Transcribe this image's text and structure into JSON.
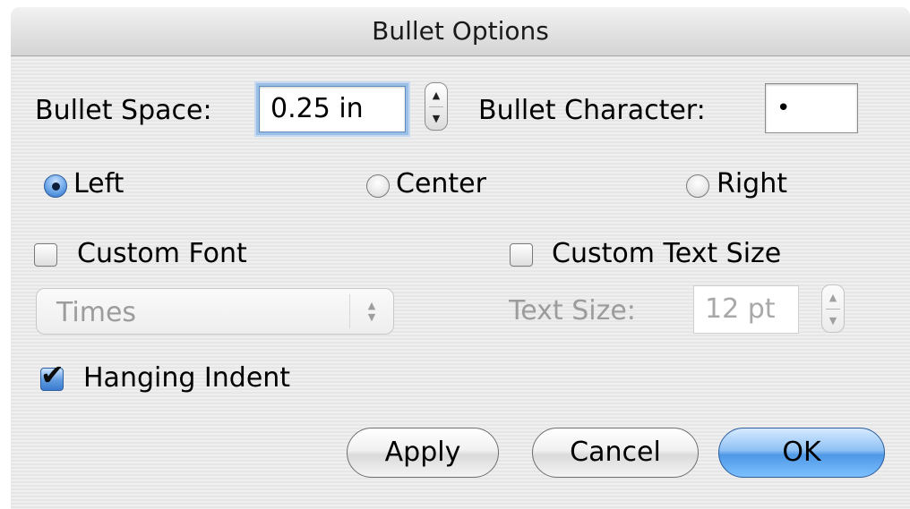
{
  "dialog": {
    "title": "Bullet Options"
  },
  "bullet_space": {
    "label": "Bullet Space:",
    "value": "0.25 in"
  },
  "bullet_character": {
    "label": "Bullet Character:",
    "value": "•"
  },
  "alignment": {
    "options": [
      {
        "label": "Left",
        "selected": true
      },
      {
        "label": "Center",
        "selected": false
      },
      {
        "label": "Right",
        "selected": false
      }
    ]
  },
  "custom_font": {
    "label": "Custom Font",
    "checked": false,
    "font_value": "Times"
  },
  "custom_text_size": {
    "label": "Custom Text Size",
    "checked": false,
    "size_label": "Text Size:",
    "size_value": "12 pt"
  },
  "hanging_indent": {
    "label": "Hanging Indent",
    "checked": true
  },
  "buttons": {
    "apply": "Apply",
    "cancel": "Cancel",
    "ok": "OK"
  },
  "icons": {
    "stepper_up": "▲",
    "stepper_down": "▼",
    "checkmark": "✔"
  },
  "colors": {
    "accent": "#4f98e6",
    "disabled_text": "#9c9c9c"
  }
}
